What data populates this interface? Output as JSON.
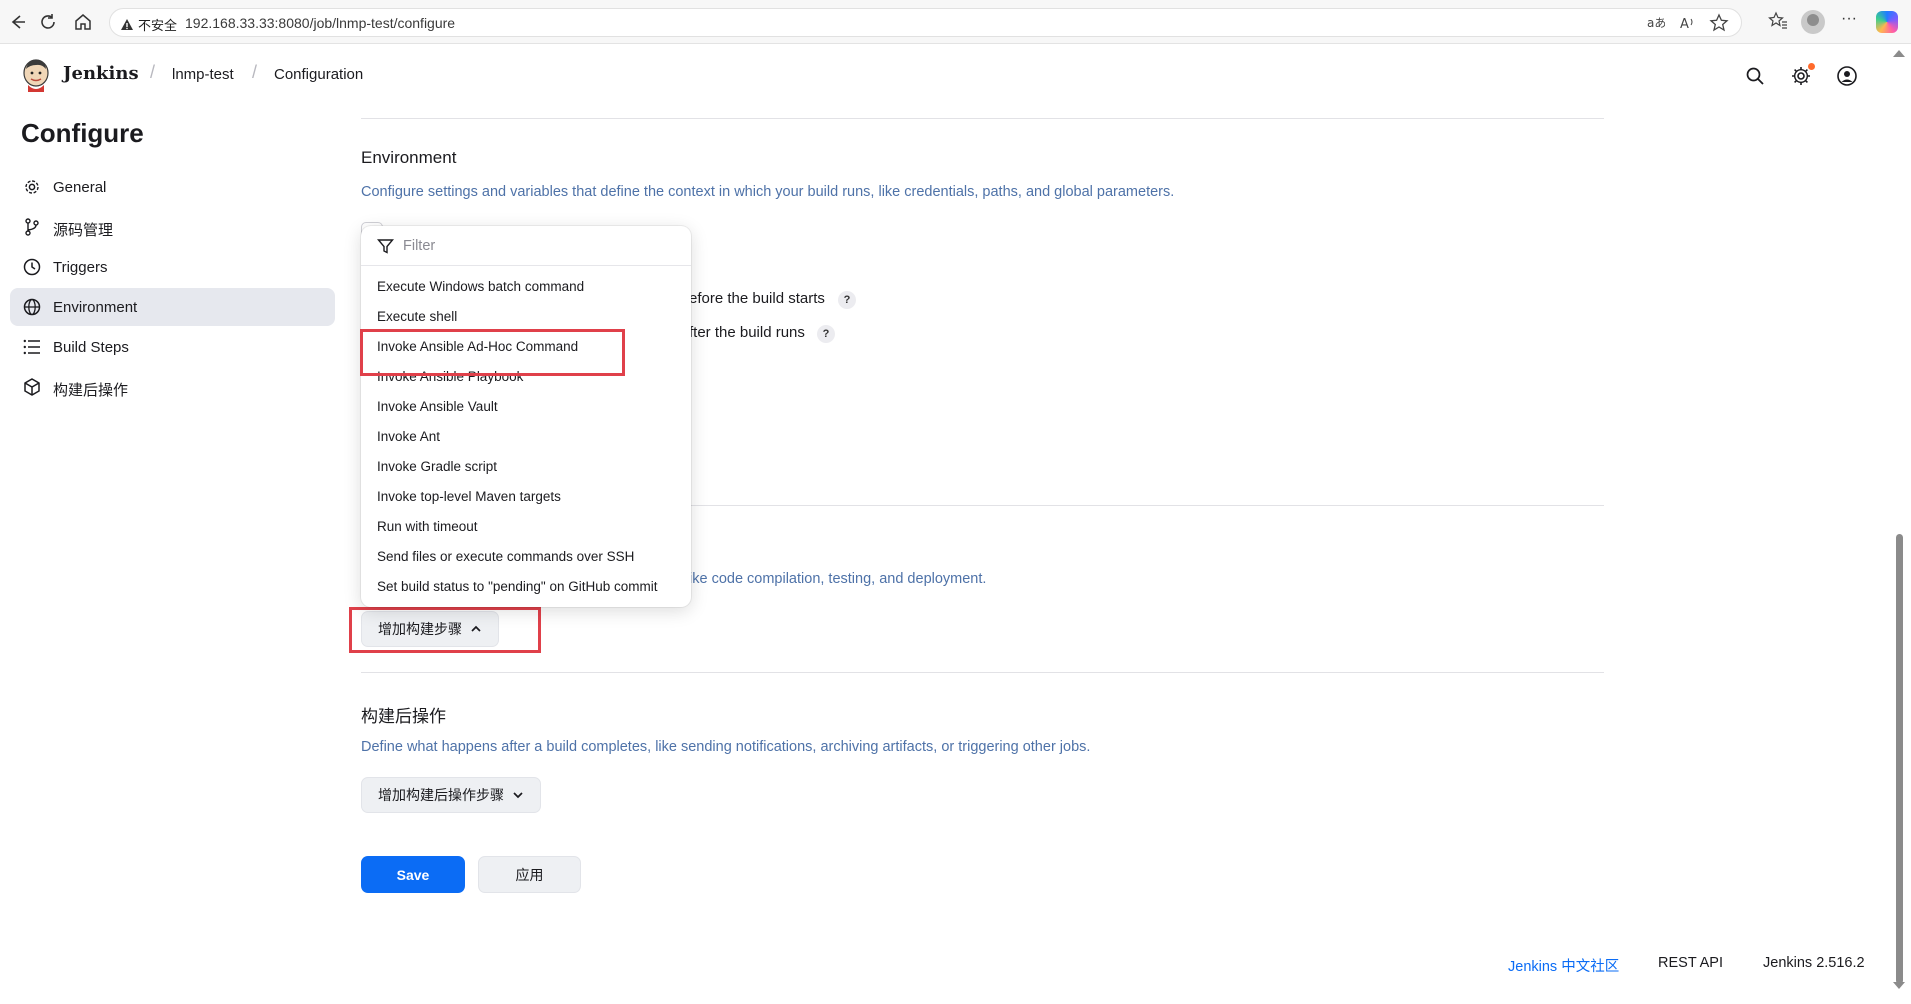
{
  "browser": {
    "insecure_label": "不安全",
    "url": "192.168.33.33:8080/job/lnmp-test/configure"
  },
  "header": {
    "brand": "Jenkins",
    "breadcrumbs": [
      "lnmp-test",
      "Configuration"
    ]
  },
  "sidebar": {
    "title": "Configure",
    "items": [
      {
        "label": "General",
        "icon": "gear-icon"
      },
      {
        "label": "源码管理",
        "icon": "branch-icon"
      },
      {
        "label": "Triggers",
        "icon": "clock-icon"
      },
      {
        "label": "Environment",
        "icon": "globe-icon",
        "active": true
      },
      {
        "label": "Build Steps",
        "icon": "list-icon"
      },
      {
        "label": "构建后操作",
        "icon": "cube-icon"
      }
    ]
  },
  "environment": {
    "title": "Environment",
    "description": "Configure settings and variables that define the context in which your build runs, like credentials, paths, and global parameters.",
    "option1_partial": "efore the build starts",
    "option2_partial": "fter the build runs",
    "help": "?"
  },
  "build_steps": {
    "description_partial": "ike code compilation, testing, and deployment.",
    "add_button": "增加构建步骤"
  },
  "dropdown": {
    "filter_placeholder": "Filter",
    "items": [
      "Execute Windows batch command",
      "Execute shell",
      "Invoke Ansible Ad-Hoc Command",
      "Invoke Ansible Playbook",
      "Invoke Ansible Vault",
      "Invoke Ant",
      "Invoke Gradle script",
      "Invoke top-level Maven targets",
      "Run with timeout",
      "Send files or execute commands over SSH",
      "Set build status to \"pending\" on GitHub commit"
    ]
  },
  "post_build": {
    "title": "构建后操作",
    "description": "Define what happens after a build completes, like sending notifications, archiving artifacts, or triggering other jobs.",
    "add_button": "增加构建后操作步骤"
  },
  "actions": {
    "save": "Save",
    "apply": "应用"
  },
  "footer": {
    "community": "Jenkins 中文社区",
    "rest_api": "REST API",
    "version": "Jenkins 2.516.2"
  },
  "colors": {
    "accent": "#0b6cf5",
    "description": "#4e72a8",
    "highlight": "#e0404a"
  }
}
